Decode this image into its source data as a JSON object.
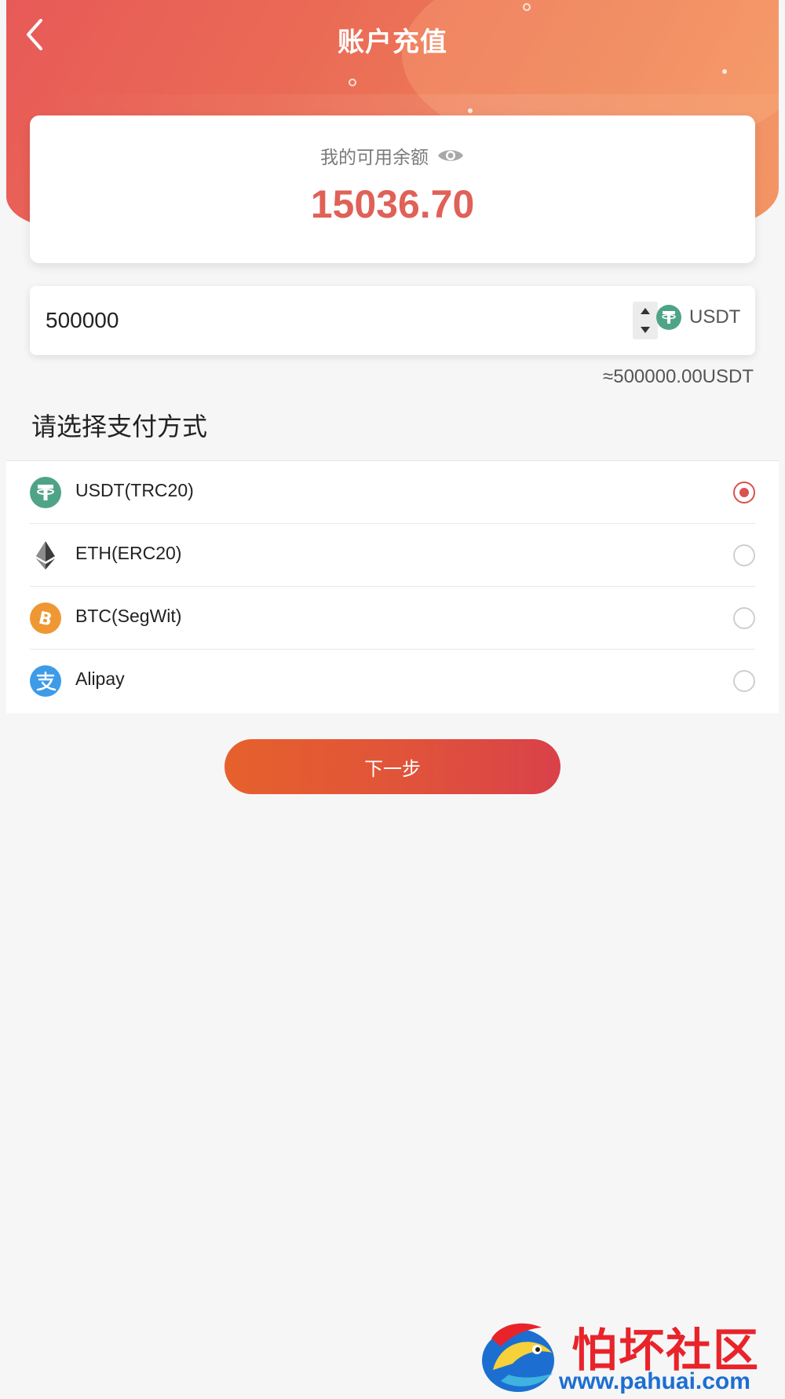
{
  "header": {
    "title": "账户充值",
    "back_icon": "chevron-left-icon"
  },
  "balance": {
    "label": "我的可用余额",
    "value": "15036.70",
    "visibility_icon": "eye-icon"
  },
  "amount": {
    "value": "500000",
    "currency": "USDT",
    "currency_icon": "tether-icon",
    "converted": "≈500000.00USDT"
  },
  "payment": {
    "section_title": "请选择支付方式",
    "methods": [
      {
        "label": "USDT(TRC20)",
        "icon": "tether-icon",
        "selected": true
      },
      {
        "label": "ETH(ERC20)",
        "icon": "ethereum-icon",
        "selected": false
      },
      {
        "label": "BTC(SegWit)",
        "icon": "bitcoin-icon",
        "selected": false
      },
      {
        "label": "Alipay",
        "icon": "alipay-icon",
        "selected": false
      }
    ]
  },
  "actions": {
    "next_label": "下一步"
  },
  "watermark": {
    "brand": "怕坏社区",
    "url": "www.pahuai.com"
  },
  "colors": {
    "accent": "#e06158",
    "button_start": "#e6612c",
    "button_end": "#d9414a",
    "tether": "#4fa488",
    "bitcoin": "#ef9833",
    "alipay": "#3d9be8"
  }
}
